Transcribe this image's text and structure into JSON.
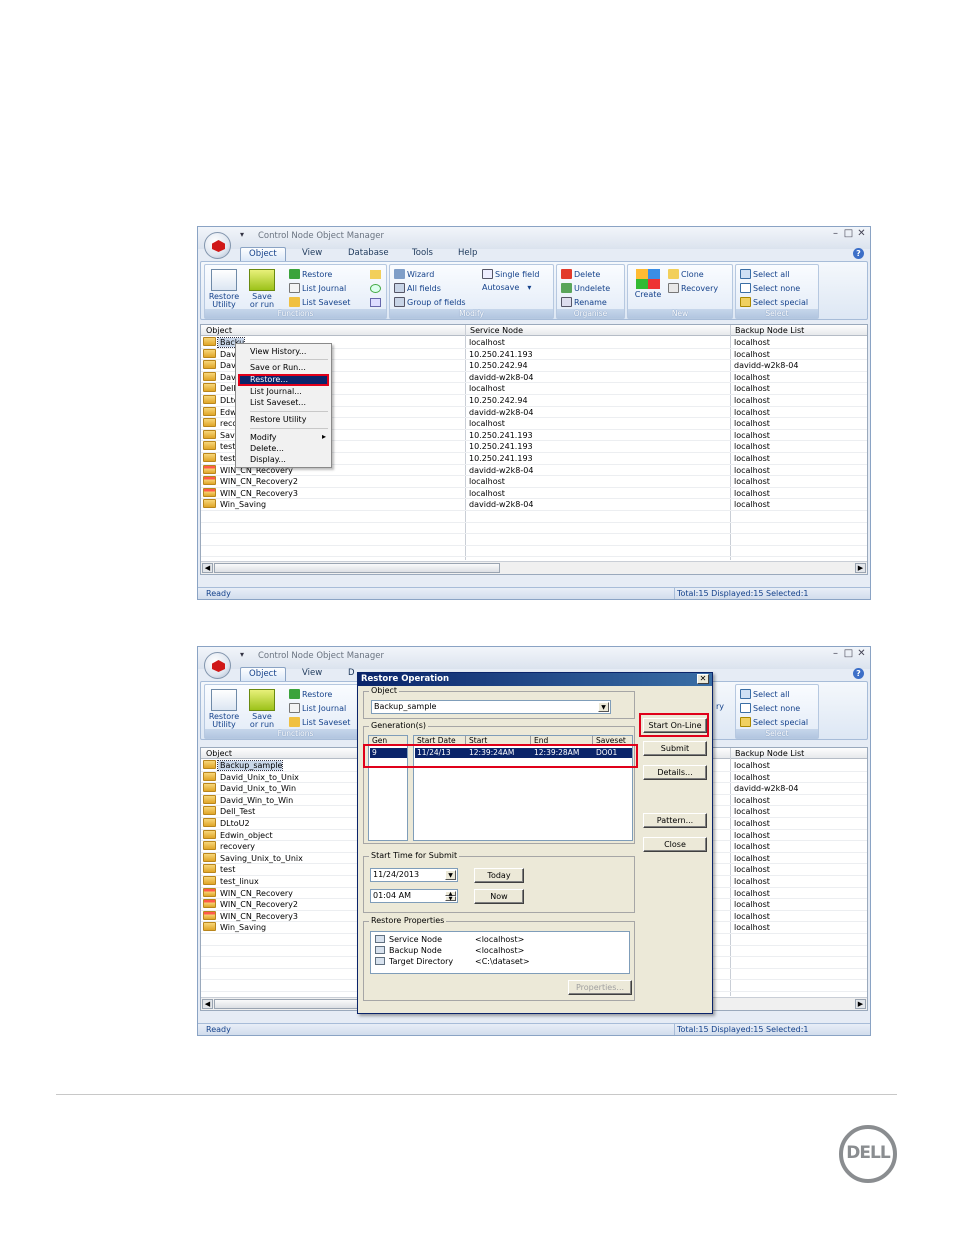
{
  "window": {
    "title": "Control Node Object Manager",
    "tabs": [
      "Object",
      "View",
      "Database",
      "Tools",
      "Help"
    ],
    "window_controls": [
      "–",
      "□",
      "✕"
    ]
  },
  "ribbon": {
    "functions": {
      "label": "Functions",
      "restore_utility": "Restore Utility",
      "restore_utility_l1": "Restore",
      "restore_utility_l2": "Utility",
      "save_run_l1": "Save",
      "save_run_l2": "or run",
      "restore": "Restore",
      "list_journal": "List Journal",
      "list_saveset": "List Saveset"
    },
    "modify": {
      "label": "Modify",
      "wizard": "Wizard",
      "all_fields": "All fields",
      "group_of_fields": "Group of fields",
      "single_field": "Single field",
      "autosave": "Autosave"
    },
    "organise": {
      "label": "Organise",
      "delete": "Delete",
      "undelete": "Undelete",
      "rename": "Rename"
    },
    "new": {
      "label": "New",
      "create": "Create",
      "clone": "Clone",
      "recovery": "Recovery"
    },
    "select": {
      "label": "Select",
      "select_all": "Select all",
      "select_none": "Select none",
      "select_special": "Select special"
    }
  },
  "grid": {
    "columns": [
      "Object",
      "Service Node",
      "Backup Node List"
    ],
    "rows": [
      {
        "object": "Backup_sample",
        "service": "localhost",
        "backup": "localhost",
        "red": false
      },
      {
        "object": "David_Unix_to_Unix",
        "service": "10.250.241.193",
        "backup": "localhost",
        "red": false
      },
      {
        "object": "David_Unix_to_Win",
        "service": "10.250.242.94",
        "backup": "davidd-w2k8-04",
        "red": false
      },
      {
        "object": "David_Win_to_Win",
        "service": "davidd-w2k8-04",
        "backup": "localhost",
        "red": false
      },
      {
        "object": "Dell_Test",
        "service": "localhost",
        "backup": "localhost",
        "red": false
      },
      {
        "object": "DLtoU2",
        "service": "10.250.242.94",
        "backup": "localhost",
        "red": false
      },
      {
        "object": "Edwin_object",
        "service": "davidd-w2k8-04",
        "backup": "localhost",
        "red": false
      },
      {
        "object": "recovery",
        "service": "localhost",
        "backup": "localhost",
        "red": false
      },
      {
        "object": "Saving_Unix_to_Unix",
        "service": "10.250.241.193",
        "backup": "localhost",
        "red": false
      },
      {
        "object": "test",
        "service": "10.250.241.193",
        "backup": "localhost",
        "red": false
      },
      {
        "object": "test_linux",
        "service": "10.250.241.193",
        "backup": "localhost",
        "red": false
      },
      {
        "object": "WIN_CN_Recovery",
        "service": "davidd-w2k8-04",
        "backup": "localhost",
        "red": true
      },
      {
        "object": "WIN_CN_Recovery2",
        "service": "localhost",
        "backup": "localhost",
        "red": true
      },
      {
        "object": "WIN_CN_Recovery3",
        "service": "localhost",
        "backup": "localhost",
        "red": true
      },
      {
        "object": "Win_Saving",
        "service": "davidd-w2k8-04",
        "backup": "localhost",
        "red": false
      }
    ]
  },
  "screenshot1_row_labels": [
    "Backup_sample",
    "Davi",
    "Davi",
    "Davi",
    "Dell",
    "DLto",
    "Edwi",
    "reco",
    "Savi",
    "test",
    "test",
    "WIN_CN_Recovery",
    "WIN_CN_Recovery2",
    "WIN_CN_Recovery3",
    "Win_Saving"
  ],
  "screenshot1_first_row_visible": "Backu",
  "context_menu": {
    "items": [
      "View History...",
      "Save or Run...",
      "Restore...",
      "List Journal...",
      "List Saveset...",
      "Restore Utility",
      "Modify",
      "Delete...",
      "Display..."
    ],
    "submenu_arrow": "▸"
  },
  "status": {
    "ready": "Ready",
    "summary": "Total:15  Displayed:15  Selected:1"
  },
  "dialog": {
    "title": "Restore Operation",
    "object_label": "Object",
    "object_value": "Backup_sample",
    "generations_label": "Generation(s)",
    "gen_columns": [
      "Gen",
      "Start Date",
      "Start",
      "End",
      "Saveset"
    ],
    "gen_row": {
      "gen": "9",
      "date": "11/24/13",
      "start": "12:39:24AM",
      "end": "12:39:28AM",
      "saveset": "DO01"
    },
    "buttons": {
      "start_online": "Start On-Line",
      "submit": "Submit",
      "details": "Details...",
      "pattern": "Pattern...",
      "close": "Close",
      "today": "Today",
      "now": "Now",
      "properties": "Properties..."
    },
    "start_time_label": "Start Time for Submit",
    "date_value": "11/24/2013",
    "time_value": "01:04 AM",
    "props_label": "Restore Properties",
    "props": [
      {
        "name": "Service Node",
        "value": "<localhost>"
      },
      {
        "name": "Backup Node",
        "value": "<localhost>"
      },
      {
        "name": "Target Directory",
        "value": "<C:\\dataset>"
      }
    ]
  },
  "ribbon_partial": {
    "ry_fragment": "ry",
    "database_fragment": "D"
  },
  "brand": {
    "logo_text": "DELL"
  }
}
